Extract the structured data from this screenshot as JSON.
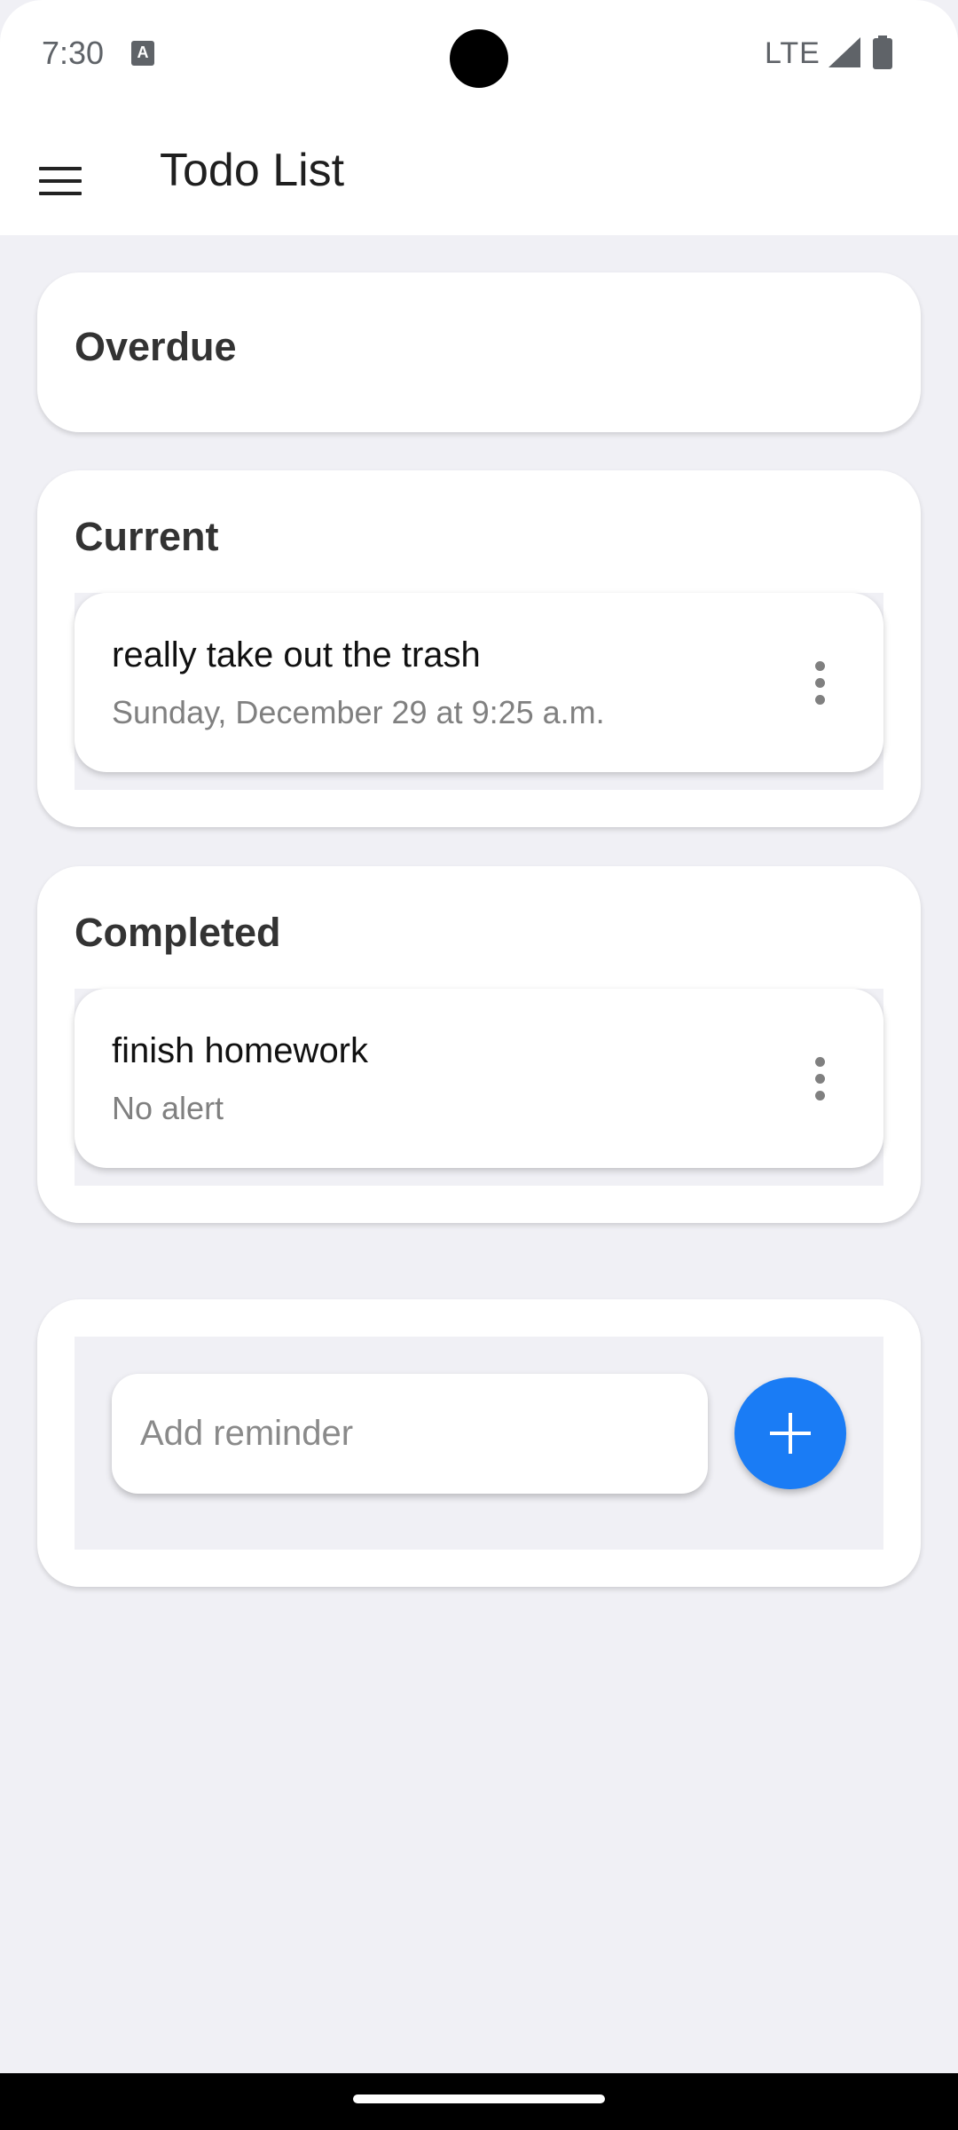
{
  "status_bar": {
    "time": "7:30",
    "notification_icon": "a-icon",
    "network": "LTE",
    "signal_icon": "signal-icon",
    "battery_icon": "battery-icon"
  },
  "app_bar": {
    "menu_icon": "menu-icon",
    "title": "Todo List"
  },
  "sections": {
    "overdue": {
      "title": "Overdue",
      "items": []
    },
    "current": {
      "title": "Current",
      "items": [
        {
          "title": "really take out the trash",
          "subtitle": "Sunday, December 29 at 9:25 a.m."
        }
      ]
    },
    "completed": {
      "title": "Completed",
      "items": [
        {
          "title": "finish homework",
          "subtitle": "No alert"
        }
      ]
    }
  },
  "add_reminder": {
    "placeholder": "Add reminder",
    "value": "",
    "add_icon": "plus-icon"
  },
  "colors": {
    "accent": "#1a7cf5",
    "background": "#f0f0f5",
    "card": "#ffffff",
    "secondary_text": "#808080"
  }
}
